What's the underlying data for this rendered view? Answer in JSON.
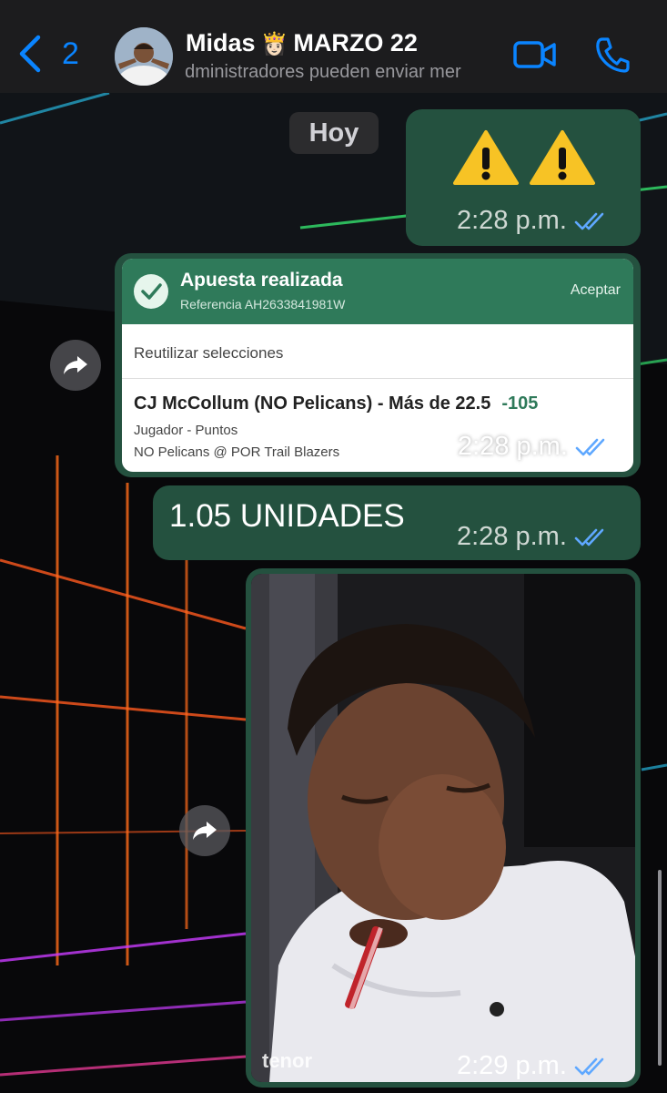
{
  "header": {
    "back_count": "2",
    "title": "Midas",
    "crown": "👸🏻",
    "title_suffix": "MARZO 22",
    "subtitle": "administradores pueden enviar mer"
  },
  "date_chip": "Hoy",
  "messages": [
    {
      "type": "emoji",
      "content": "⚠️ ⚠️",
      "time": "2:28 p.m."
    },
    {
      "type": "bet_card",
      "title": "Apuesta realizada",
      "reference": "Referencia AH2633841981W",
      "accept_label": "Aceptar",
      "reuse_label": "Reutilizar selecciones",
      "pick": "CJ McCollum (NO Pelicans) - Más de 22.5",
      "odds": "-105",
      "market": "Jugador - Puntos",
      "game": "NO Pelicans @ POR Trail Blazers",
      "time": "2:28 p.m."
    },
    {
      "type": "text",
      "content": "1.05 UNIDADES",
      "time": "2:28 p.m."
    },
    {
      "type": "gif",
      "watermark": "tenor",
      "time": "2:29 p.m."
    }
  ],
  "icons": {
    "back": "chevron-left-icon",
    "video": "video-camera-icon",
    "call": "phone-icon",
    "forward": "forward-arrow-icon",
    "check": "checkmark-circle-icon",
    "read": "double-check-icon",
    "warning": "warning-icon"
  },
  "colors": {
    "accent": "#0a84ff",
    "bubble": "#24513f",
    "bet_header": "#2f7a5a",
    "read_ticks": "#5fa8ff"
  }
}
